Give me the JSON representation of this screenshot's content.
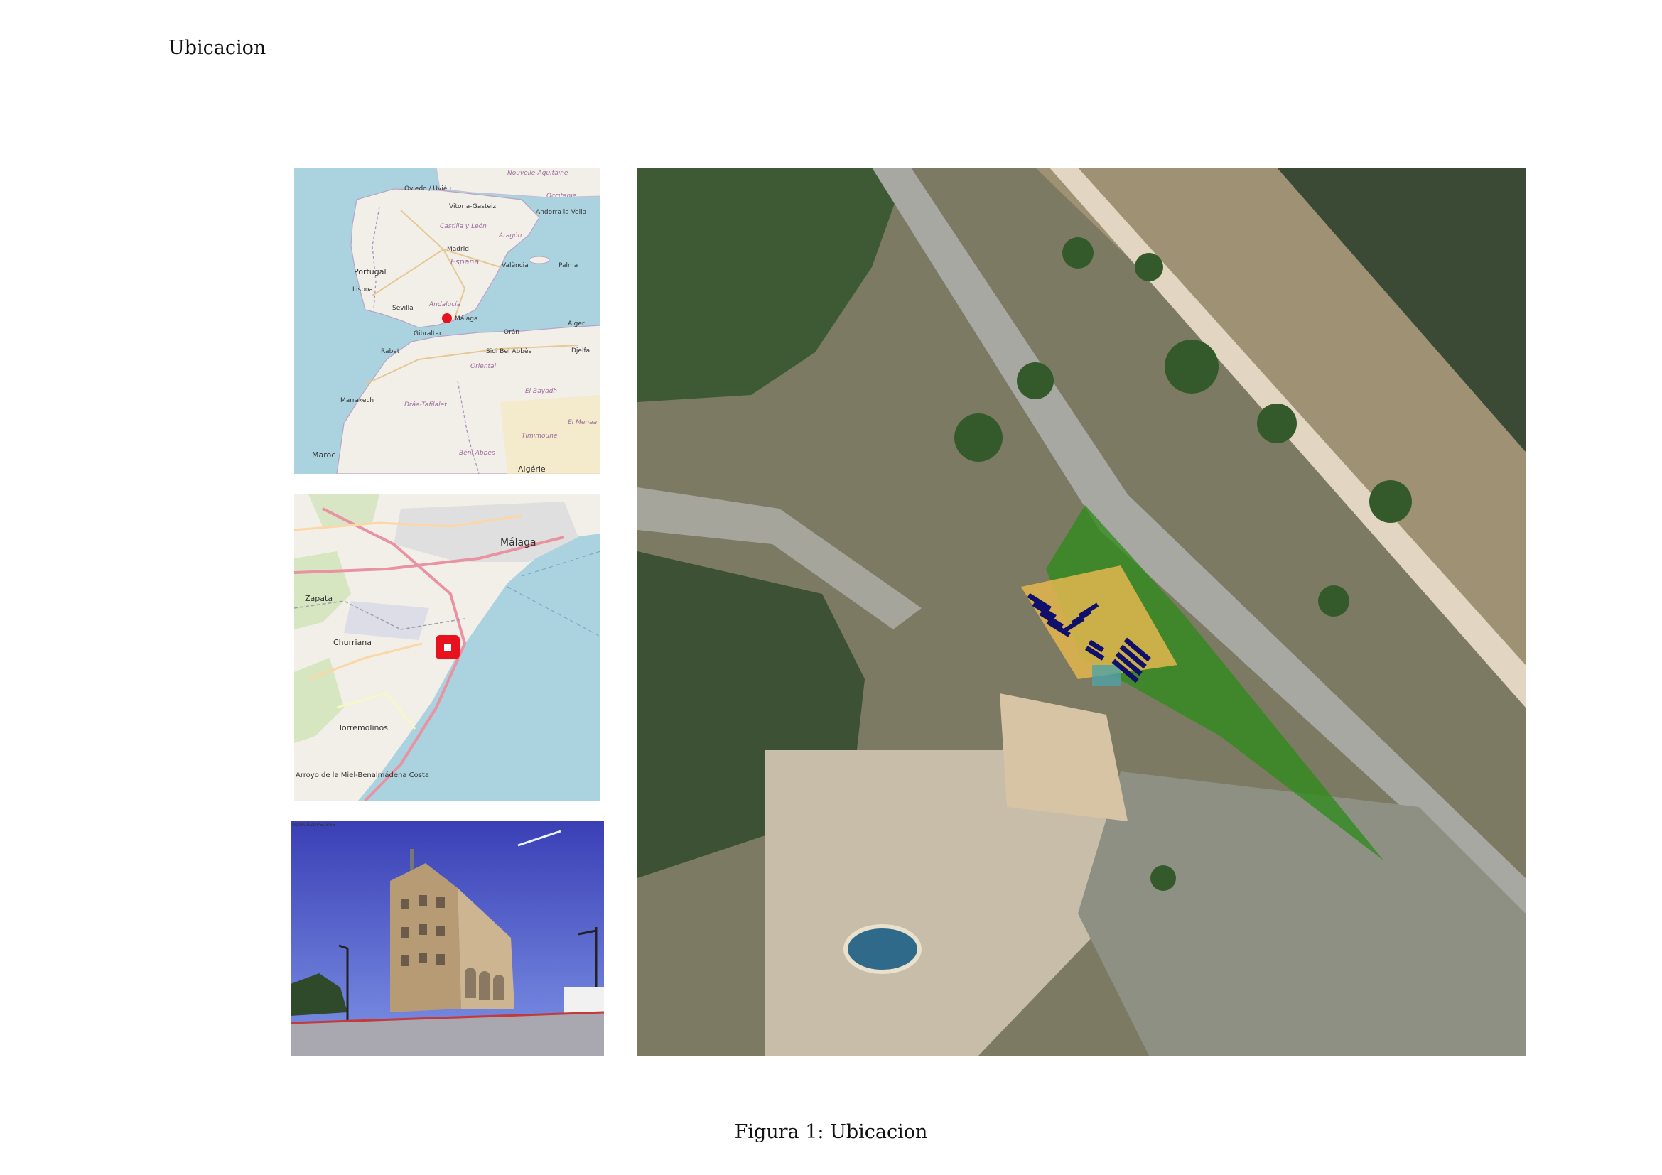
{
  "header": {
    "title": "Ubicacion"
  },
  "figure": {
    "caption_prefix": "Figura 1:",
    "caption_text": "Ubicacion"
  },
  "iberia_map": {
    "labels": [
      "Nouvelle-Aquitaine",
      "Oviedo / Uviéu",
      "Vitoria-Gasteiz",
      "Occitanie",
      "Andorra la Vella",
      "Castilla y León",
      "Aragón",
      "Portugal",
      "Madrid",
      "España",
      "València",
      "Palma",
      "Lisboa",
      "Andalucía",
      "Sevilla",
      "Málaga",
      "Gibraltar",
      "Orán",
      "Alger",
      "Rabat",
      "Sidi Bel Abbès",
      "Djelfa",
      "Oriental",
      "Marrakech",
      "Drâa-Tafilalet",
      "El Bayadh",
      "El Menaa",
      "Timimoune",
      "Maroc",
      "Béni Abbès",
      "Algérie"
    ]
  },
  "malaga_map": {
    "labels": [
      "Málaga",
      "Zapata",
      "Churriana",
      "Torremolinos",
      "Arroyo de la Miel-Benalmádena Costa"
    ]
  },
  "photo": {
    "watermark": "NON062UPE086B"
  },
  "colors": {
    "sea": "#aad3df",
    "land": "#f2efe9",
    "marker": "#e8121e",
    "parcel_green": "#2f8a1c",
    "solar_panels": "#10106a"
  }
}
